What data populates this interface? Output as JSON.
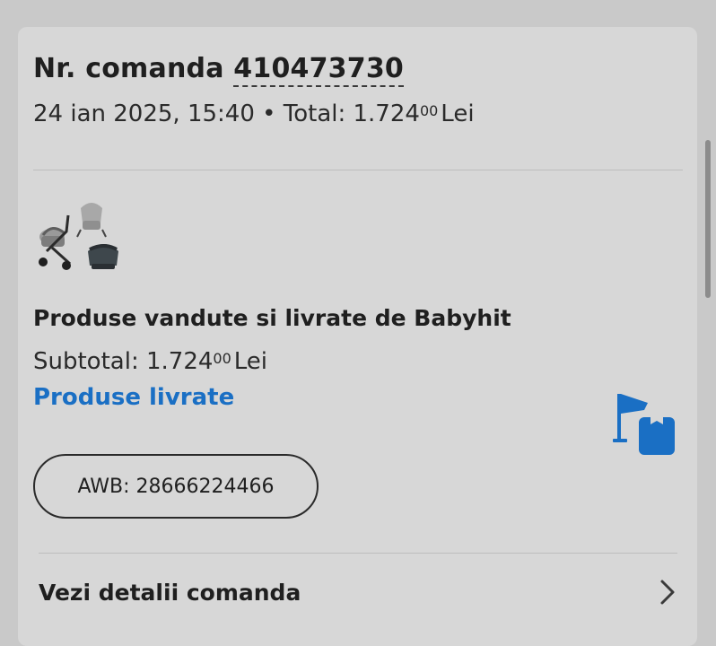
{
  "order": {
    "title_prefix": "Nr. comanda ",
    "number": "410473730",
    "date": "24 ian 2025, 15:40",
    "separator": " • ",
    "total_label": "Total: ",
    "total_int": "1.724",
    "total_dec": "00",
    "currency": "Lei"
  },
  "seller": {
    "line": "Produse vandute si livrate de Babyhit",
    "subtotal_label": "Subtotal: ",
    "subtotal_int": "1.724",
    "subtotal_dec": "00",
    "currency": "Lei",
    "status": "Produse livrate",
    "product_thumbnail_icon": "stroller-set-thumbnail",
    "status_icon": "delivered-flag-box-icon",
    "awb_label": "AWB: 28666224466"
  },
  "footer": {
    "details_label": "Vezi detalii comanda",
    "chevron_icon": "chevron-right-icon"
  },
  "colors": {
    "accent_blue": "#1a6fc4",
    "card_background": "#d7d7d7",
    "page_background": "#c9c9c9"
  }
}
